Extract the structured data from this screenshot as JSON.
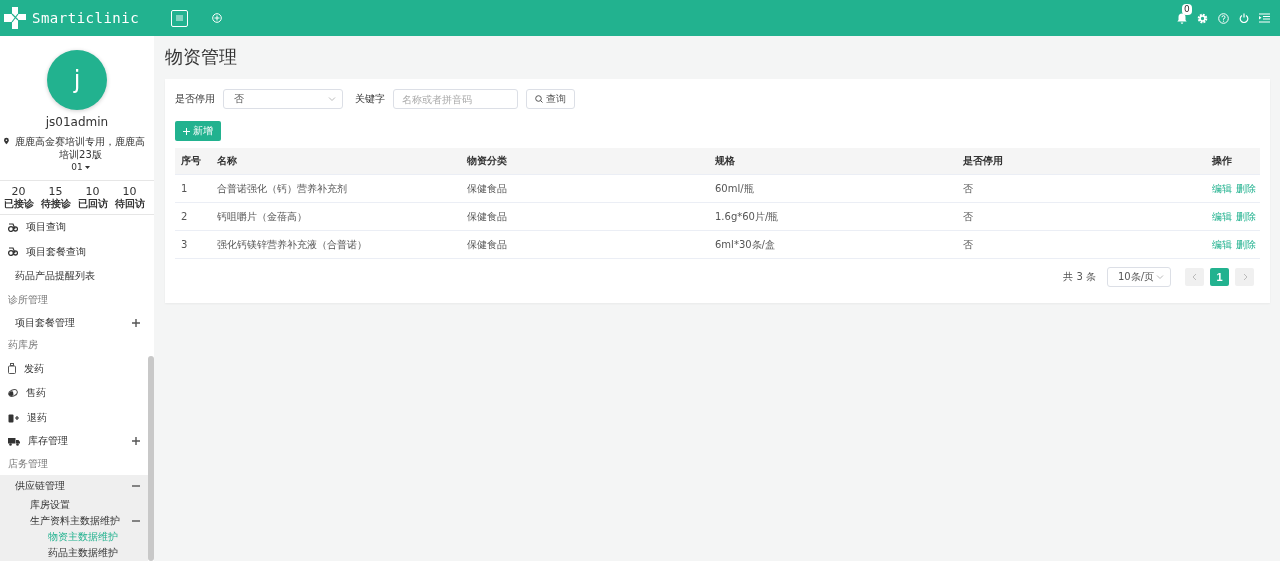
{
  "header": {
    "app_name": "Smarticlinic",
    "notification_count": "0"
  },
  "profile": {
    "avatar_letter": "j",
    "username": "js01admin",
    "location": "鹿鹿高金赛培训专用，鹿鹿高培训23版",
    "location_suffix": "01"
  },
  "stats": [
    {
      "value": "20",
      "label": "已接诊"
    },
    {
      "value": "15",
      "label": "待接诊"
    },
    {
      "value": "10",
      "label": "已回访"
    },
    {
      "value": "10",
      "label": "待回访"
    }
  ],
  "menu": [
    {
      "kind": "item",
      "label": "项目查询",
      "selected": false
    },
    {
      "kind": "item",
      "label": "项目套餐查询",
      "selected": false
    },
    {
      "kind": "item",
      "label": "药品产品提醒列表",
      "selected": false
    },
    {
      "kind": "section",
      "label": "诊所管理"
    },
    {
      "kind": "group",
      "label": "项目套餐管理",
      "expanded": false
    },
    {
      "kind": "section",
      "label": "药库房"
    },
    {
      "kind": "item",
      "label": "发药",
      "selected": false
    },
    {
      "kind": "item",
      "label": "售药",
      "selected": false
    },
    {
      "kind": "item",
      "label": "退药",
      "selected": false
    },
    {
      "kind": "group",
      "label": "库存管理",
      "expanded": false
    },
    {
      "kind": "section",
      "label": "店务管理"
    },
    {
      "kind": "group",
      "label": "供应链管理",
      "expanded": true,
      "children": [
        {
          "kind": "item",
          "label": "库房设置",
          "selected": false
        },
        {
          "kind": "group",
          "label": "生产资料主数据维护",
          "expanded": true,
          "children": [
            {
              "kind": "item",
              "label": "物资主数据维护",
              "selected": true
            },
            {
              "kind": "item",
              "label": "药品主数据维护",
              "selected": false
            }
          ]
        }
      ]
    }
  ],
  "page_title": "物资管理",
  "filters": {
    "disabled_label": "是否停用",
    "disabled_value": "否",
    "keyword_label": "关键字",
    "keyword_placeholder": "名称或者拼音码",
    "search_button": "查询"
  },
  "add_button": "新增",
  "table": {
    "columns": [
      "序号",
      "名称",
      "物资分类",
      "规格",
      "是否停用",
      "操作"
    ],
    "rows": [
      {
        "cells": [
          "1",
          "合普诺强化（钙）营养补充剂",
          "保健食品",
          "60ml/瓶",
          "否"
        ],
        "actions": [
          "编辑",
          "删除"
        ]
      },
      {
        "cells": [
          "2",
          "钙咀嚼片（金蓓高）",
          "保健食品",
          "1.6g*60片/瓶",
          "否"
        ],
        "actions": [
          "编辑",
          "删除"
        ]
      },
      {
        "cells": [
          "3",
          "强化钙镁锌营养补充液（合普诺）",
          "保健食品",
          "6ml*30条/盒",
          "否"
        ],
        "actions": [
          "编辑",
          "删除"
        ]
      }
    ]
  },
  "pagination": {
    "total": "共 3 条",
    "page_size": "10条/页",
    "pages": [
      {
        "label": "1",
        "selected": true
      }
    ]
  }
}
